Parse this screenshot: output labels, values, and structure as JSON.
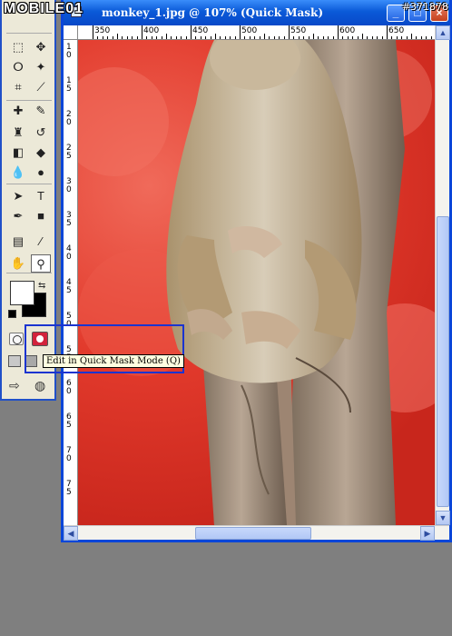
{
  "window": {
    "title": "monkey_1.jpg @ 107% (Quick Mask)",
    "buttons": {
      "minimize": "_",
      "maximize": "□",
      "close": "×"
    }
  },
  "ruler_h": [
    "350",
    "400",
    "450",
    "500",
    "550",
    "600",
    "650"
  ],
  "ruler_v": [
    "1",
    "0",
    "1",
    "5",
    "2",
    "0",
    "2",
    "5",
    "3",
    "0",
    "3",
    "5",
    "4",
    "0",
    "4",
    "5",
    "5",
    "0",
    "5",
    "5",
    "6",
    "0",
    "6",
    "5",
    "7",
    "0",
    "7",
    "5"
  ],
  "tooltip": "Edit in Quick Mask Mode (Q)",
  "watermark": {
    "logo": "MOBILE01",
    "id": "#371878"
  },
  "toolbox": {
    "tools": [
      {
        "icon": "marquee-icon",
        "glyph": "⬚"
      },
      {
        "icon": "move-icon",
        "glyph": "✥"
      },
      {
        "icon": "lasso-icon",
        "glyph": "ⵔ"
      },
      {
        "icon": "magic-wand-icon",
        "glyph": "✦"
      },
      {
        "icon": "crop-icon",
        "glyph": "⌗"
      },
      {
        "icon": "slice-icon",
        "glyph": "⟋"
      },
      {
        "icon": "healing-brush-icon",
        "glyph": "✚"
      },
      {
        "icon": "brush-icon",
        "glyph": "✎"
      },
      {
        "icon": "clone-stamp-icon",
        "glyph": "♜"
      },
      {
        "icon": "history-brush-icon",
        "glyph": "↺"
      },
      {
        "icon": "eraser-icon",
        "glyph": "◧"
      },
      {
        "icon": "paint-bucket-icon",
        "glyph": "◆"
      },
      {
        "icon": "blur-icon",
        "glyph": "💧"
      },
      {
        "icon": "dodge-icon",
        "glyph": "●"
      },
      {
        "icon": "path-selection-icon",
        "glyph": "➤"
      },
      {
        "icon": "type-icon",
        "glyph": "T"
      },
      {
        "icon": "pen-icon",
        "glyph": "✒"
      },
      {
        "icon": "rectangle-icon",
        "glyph": "■"
      },
      {
        "icon": "notes-icon",
        "glyph": "▤"
      },
      {
        "icon": "eyedropper-icon",
        "glyph": "⁄"
      },
      {
        "icon": "hand-icon",
        "glyph": "✋"
      },
      {
        "icon": "zoom-icon",
        "glyph": "⚲"
      }
    ]
  }
}
